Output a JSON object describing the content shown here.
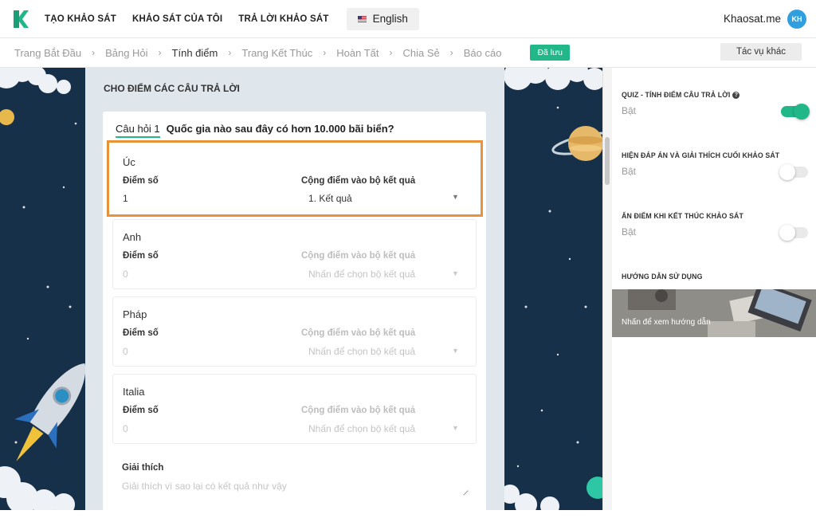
{
  "nav": {
    "links": [
      "TẠO KHẢO SÁT",
      "KHẢO SÁT CỦA TÔI",
      "TRẢ LỜI KHẢO SÁT"
    ],
    "language": "English",
    "brand": "Khaosat.me",
    "avatar_initials": "KH"
  },
  "breadcrumb": {
    "steps": [
      "Trang Bắt Đầu",
      "Bảng Hỏi",
      "Tính điểm",
      "Trang Kết Thúc",
      "Hoàn Tất",
      "Chia Sẻ",
      "Báo cáo"
    ],
    "active_index": 2,
    "separator": "›",
    "saved_badge": "Đã lưu",
    "other_tasks": "Tác vụ khác"
  },
  "editor": {
    "section_title": "CHO ĐIỂM CÁC CÂU TRẢ LỜI",
    "question_number": "Câu hỏi 1",
    "question_text": "Quốc gia nào sau đây có hơn 10.000 bãi biển?",
    "score_label": "Điểm số",
    "result_label": "Cộng điểm vào bộ kết quả",
    "answers": [
      {
        "name": "Úc",
        "score": "1",
        "result": "1. Kết quả"
      },
      {
        "name": "Anh",
        "score": "0",
        "result": "Nhấn để chọn bộ kết quả"
      },
      {
        "name": "Pháp",
        "score": "0",
        "result": "Nhấn để chọn bộ kết quả"
      },
      {
        "name": "Italia",
        "score": "0",
        "result": "Nhấn để chọn bộ kết quả"
      }
    ],
    "explanation_label": "Giải thích",
    "explanation_placeholder": "Giải thích vì sao lại có kết quả như vậy"
  },
  "settings": {
    "quiz_title": "QUIZ - TÍNH ĐIỂM CÂU TRẢ LỜI",
    "quiz_state": "Bật",
    "quiz_on": true,
    "show_answers_title": "HIỆN ĐÁP ÁN VÀ GIẢI THÍCH CUỐI KHẢO SÁT",
    "show_answers_state": "Bật",
    "show_answers_on": false,
    "hide_score_title": "ẨN ĐIỂM KHI KẾT THÚC KHẢO SÁT",
    "hide_score_state": "Bật",
    "hide_score_on": false,
    "guide_title": "HƯỚNG DẪN SỬ DỤNG",
    "guide_link": "Nhấn để xem hướng dẫn"
  },
  "colors": {
    "accent": "#21b789",
    "highlight": "#e8923a",
    "space_bg": "#17304a"
  }
}
